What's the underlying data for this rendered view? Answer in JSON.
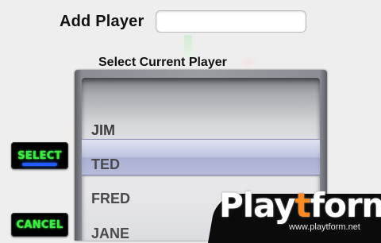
{
  "add_player": {
    "label": "Add Player",
    "value": ""
  },
  "picker": {
    "title": "Select Current Player",
    "items": [
      {
        "label": "JIM"
      },
      {
        "label": "TED"
      },
      {
        "label": "FRED"
      },
      {
        "label": "JANE"
      }
    ],
    "selected": "TED"
  },
  "buttons": {
    "select_label": "SELECT",
    "cancel_label": "CANCEL"
  },
  "watermark": {
    "logo_text": "Playtform",
    "url": "www.playtform.net"
  },
  "colors": {
    "button_text": "#34f03c",
    "button_bg": "#000000",
    "selection_band": "#aab0d8",
    "logo_accent": "#ff8a1f"
  }
}
